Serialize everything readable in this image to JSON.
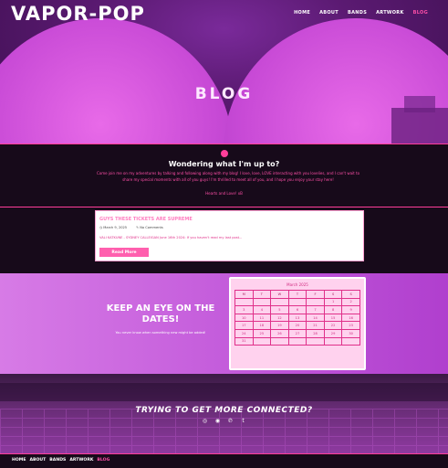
{
  "site": {
    "logo": "VAPOR-POP"
  },
  "nav": {
    "items": [
      {
        "label": "HOME"
      },
      {
        "label": "ABOUT"
      },
      {
        "label": "BANDS"
      },
      {
        "label": "ARTWORK"
      },
      {
        "label": "BLOG"
      }
    ],
    "active": "BLOG"
  },
  "hero": {
    "title": "BLOG"
  },
  "intro": {
    "heading": "Wondering what I'm up to?",
    "body": "Come join me on my adventures by talking and following along with my blog! I love, love, LOVE interacting with you lovelies, and I can't wait to share my special moments with all of you guys! I'm thrilled to meet all of you, and I hope you enjoy your stay here!",
    "signoff": "Hearts and Love! xB"
  },
  "post": {
    "title": "GUYS THESE TICKETS ARE SUPREME",
    "date": "March 9, 2025",
    "comments": "No Comments",
    "excerpt": "VALI KATKUNE - SYDNEY CALLEIGAN June 16th 2024: If you haven't read my last post...",
    "read_more": "Read More"
  },
  "dates": {
    "heading": "KEEP AN EYE ON THE DATES!",
    "sub": "You never know when something new might be added!"
  },
  "calendar": {
    "month": "March 2025",
    "headers": [
      "M",
      "T",
      "W",
      "T",
      "F",
      "S",
      "S"
    ],
    "rows": [
      [
        "",
        "",
        "",
        "",
        "",
        "1",
        "2"
      ],
      [
        "3",
        "4",
        "5",
        "6",
        "7",
        "8",
        "9"
      ],
      [
        "10",
        "11",
        "12",
        "13",
        "14",
        "15",
        "16"
      ],
      [
        "17",
        "18",
        "19",
        "20",
        "21",
        "22",
        "23"
      ],
      [
        "24",
        "25",
        "26",
        "27",
        "28",
        "29",
        "30"
      ],
      [
        "31",
        "",
        "",
        "",
        "",
        "",
        ""
      ]
    ]
  },
  "connect": {
    "heading": "TRYING TO GET MORE CONNECTED?",
    "icons": [
      "instagram-icon",
      "discord-icon",
      "pinterest-icon",
      "tumblr-icon"
    ]
  },
  "footer": {
    "links": [
      {
        "label": "HOME"
      },
      {
        "label": "ABOUT"
      },
      {
        "label": "BANDS"
      },
      {
        "label": "ARTWORK"
      },
      {
        "label": "BLOG"
      }
    ]
  },
  "colors": {
    "accent": "#ff4fa8",
    "hero_bg": "#5b1a72",
    "dates_bg": "#c056d9",
    "dark_bg": "#170a1a"
  }
}
